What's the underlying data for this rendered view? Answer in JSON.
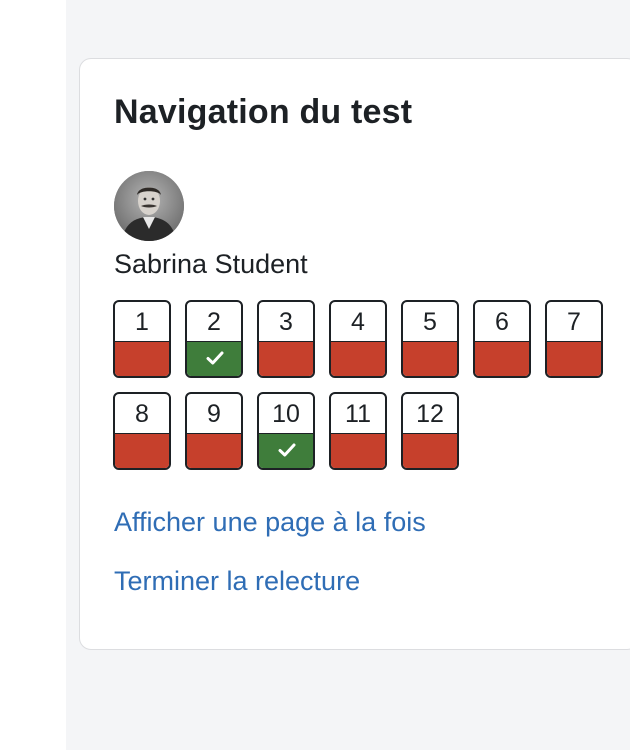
{
  "block": {
    "title": "Navigation du test",
    "user": {
      "name": "Sabrina Student",
      "avatar_icon": "user-photo"
    },
    "questions": [
      {
        "label": "1",
        "state": "incorrect"
      },
      {
        "label": "2",
        "state": "correct"
      },
      {
        "label": "3",
        "state": "incorrect"
      },
      {
        "label": "4",
        "state": "incorrect"
      },
      {
        "label": "5",
        "state": "incorrect"
      },
      {
        "label": "6",
        "state": "incorrect"
      },
      {
        "label": "7",
        "state": "incorrect"
      },
      {
        "label": "8",
        "state": "incorrect"
      },
      {
        "label": "9",
        "state": "incorrect"
      },
      {
        "label": "10",
        "state": "correct"
      },
      {
        "label": "11",
        "state": "incorrect"
      },
      {
        "label": "12",
        "state": "incorrect"
      }
    ],
    "links": {
      "show_one_page": "Afficher une page à la fois",
      "finish_review": "Terminer la relecture"
    }
  },
  "colors": {
    "correct": "#3f7d3b",
    "incorrect": "#c6402c",
    "link": "#2f6db5",
    "text": "#1d2125"
  }
}
